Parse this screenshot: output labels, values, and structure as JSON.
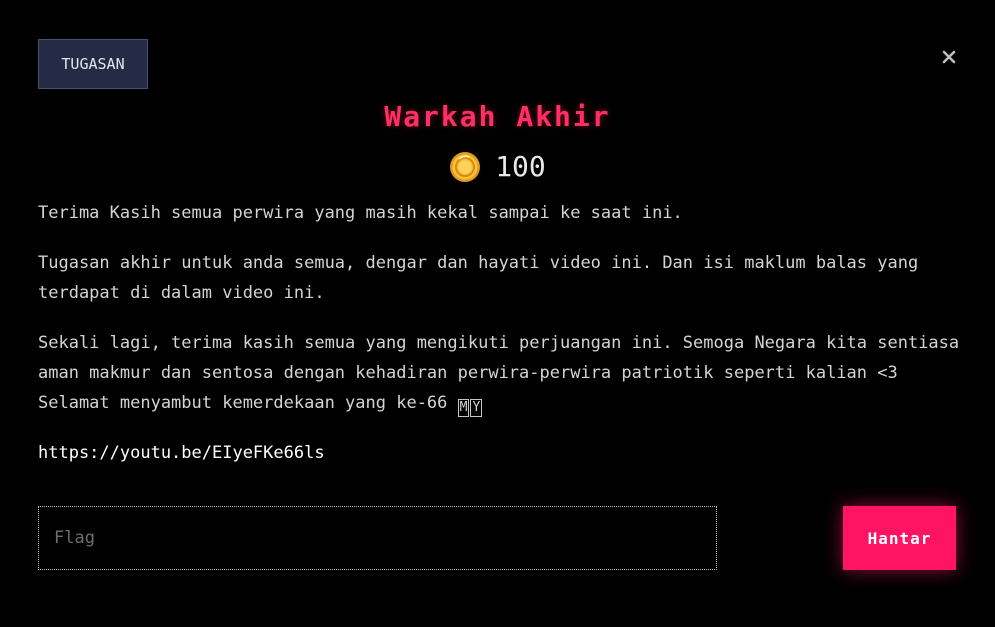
{
  "header": {
    "tag_label": "TUGASAN"
  },
  "challenge": {
    "title": "Warkah Akhir",
    "points": "100",
    "description": {
      "p1": "Terima Kasih semua perwira yang masih kekal sampai ke saat ini.",
      "p2_line1": "Tugasan akhir untuk anda semua, dengar dan hayati video ini. Dan isi maklum balas yang",
      "p2_line2": "terdapat di dalam video ini.",
      "p3_line1": "Sekali lagi, terima kasih semua yang mengikuti perjuangan ini. Semoga Negara kita sentiasa",
      "p3_line2": "aman makmur dan sentosa dengan kehadiran perwira-perwira patriotik seperti kalian <3",
      "p3_line3": "Selamat menyambut kemerdekaan yang ke-66",
      "flag_letter_1": "M",
      "flag_letter_2": "Y",
      "link": "https://youtu.be/EIyeFKe66ls"
    }
  },
  "form": {
    "flag_placeholder": "Flag",
    "flag_value": "",
    "submit_label": "Hantar"
  },
  "icons": {
    "close": "close-icon",
    "coin": "coin-icon"
  },
  "colors": {
    "background": "#000000",
    "accent": "#ff1464",
    "title": "#ff2e63",
    "tag_bg": "#262b45",
    "coin": "#f5b83d"
  }
}
